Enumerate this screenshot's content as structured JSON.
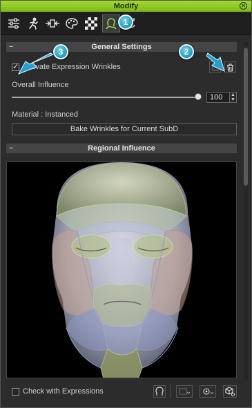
{
  "window": {
    "title": "Modify"
  },
  "toolbar": {
    "tools": [
      {
        "name": "sliders-icon",
        "glyph": "☰"
      },
      {
        "name": "motion-icon",
        "glyph": "🏃"
      },
      {
        "name": "stretch-icon",
        "glyph": "↔"
      },
      {
        "name": "palette-icon",
        "glyph": "🎨"
      },
      {
        "name": "checker-icon",
        "glyph": "▦"
      },
      {
        "name": "head-icon",
        "glyph": "☺"
      },
      {
        "name": "refresh-icon",
        "glyph": "⟳"
      }
    ]
  },
  "callouts": {
    "one": "1",
    "two": "2",
    "three": "3"
  },
  "general": {
    "header": "General Settings",
    "activate_label": "Activate Expression Wrinkles",
    "activate_checked": true,
    "overall_label": "Overall Influence",
    "overall_value": "100",
    "overall_fraction": 1.0,
    "material_label": "Material : Instanced",
    "bake_button": "Bake Wrinkles for Current SubD"
  },
  "regional": {
    "header": "Regional Influence"
  },
  "footer": {
    "check_label": "Check with Expressions",
    "check_checked": false
  },
  "colors": {
    "accent": "#8cc63f",
    "callout": "#29a8d0",
    "arrow": "#1fa1d4"
  }
}
